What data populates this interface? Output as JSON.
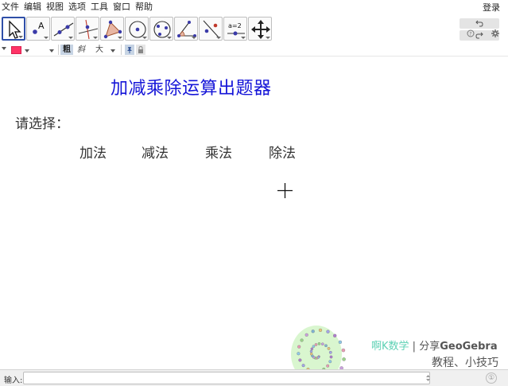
{
  "menu": {
    "items": [
      "文件",
      "编辑",
      "视图",
      "选项",
      "工具",
      "窗口",
      "帮助"
    ],
    "login": "登录"
  },
  "toolbar": {
    "tools": [
      {
        "name": "move-tool-icon",
        "active": true
      },
      {
        "name": "point-tool-icon",
        "letter": "A"
      },
      {
        "name": "line-tool-icon"
      },
      {
        "name": "perpendicular-line-tool-icon"
      },
      {
        "name": "polygon-tool-icon"
      },
      {
        "name": "circle-center-point-tool-icon"
      },
      {
        "name": "circle-three-points-tool-icon"
      },
      {
        "name": "angle-tool-icon"
      },
      {
        "name": "reflect-tool-icon"
      },
      {
        "name": "slider-tool-icon",
        "label": "a=2"
      },
      {
        "name": "move-graphics-view-tool-icon"
      }
    ],
    "undo_icon": "undo-icon",
    "redo_icon": "redo-icon",
    "help_icon": "help-icon",
    "settings_icon": "gear-icon"
  },
  "stylebar": {
    "color": "#ff3366",
    "bold_label": "粗",
    "italic_label": "斜",
    "size_label": "大"
  },
  "canvas": {
    "title": "加减乘除运算出题器",
    "prompt": "请选择：",
    "operations": [
      "加法",
      "减法",
      "乘法",
      "除法"
    ],
    "title_color": "#1515d8"
  },
  "watermark": {
    "brand": "啊K数学",
    "separator": "|",
    "share": "分享",
    "geogebra": "GeoGebra",
    "line2": "教程、小技巧",
    "brand_color": "#5dd1b4"
  },
  "inputbar": {
    "label": "输入:",
    "value": "",
    "help": "①"
  }
}
